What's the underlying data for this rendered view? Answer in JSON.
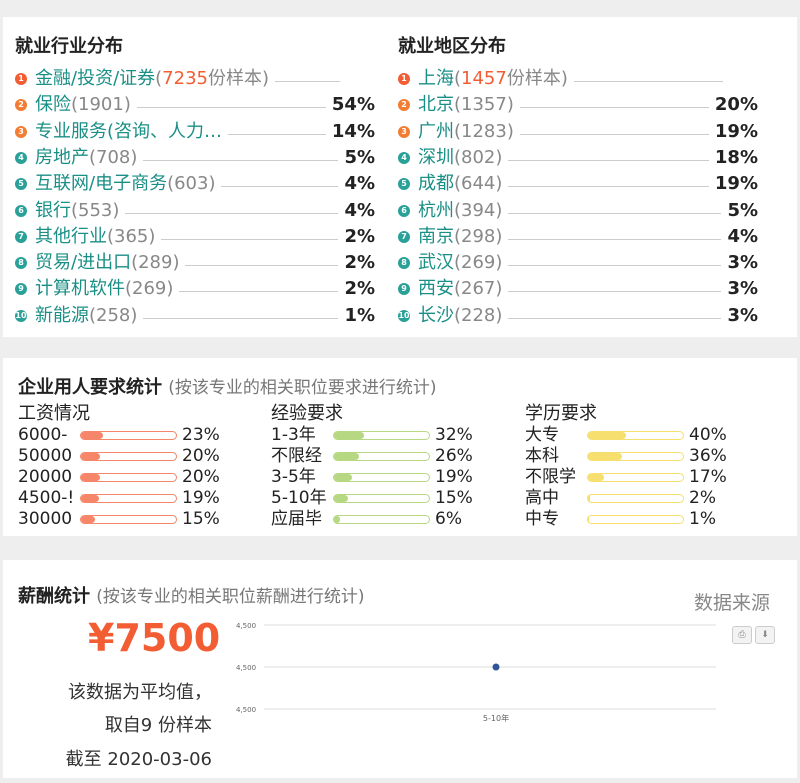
{
  "industry": {
    "title": "就业行业分布",
    "items": [
      {
        "rank": "1",
        "name": "金融/投资/证券",
        "count": "(",
        "count_hl": "7235",
        "count_tail": "份样本)",
        "pct": ""
      },
      {
        "rank": "2",
        "name": "保险",
        "count": "(1901)",
        "count_hl": "",
        "count_tail": "",
        "pct": "54%"
      },
      {
        "rank": "3",
        "name": "专业服务(咨询、人力…",
        "count": "",
        "count_hl": "",
        "count_tail": "",
        "pct": "14%"
      },
      {
        "rank": "4",
        "name": "房地产",
        "count": "(708)",
        "count_hl": "",
        "count_tail": "",
        "pct": "5%"
      },
      {
        "rank": "5",
        "name": "互联网/电子商务",
        "count": "(603)",
        "count_hl": "",
        "count_tail": "",
        "pct": "4%"
      },
      {
        "rank": "6",
        "name": "银行",
        "count": "(553)",
        "count_hl": "",
        "count_tail": "",
        "pct": "4%"
      },
      {
        "rank": "7",
        "name": "其他行业",
        "count": "(365)",
        "count_hl": "",
        "count_tail": "",
        "pct": "2%"
      },
      {
        "rank": "8",
        "name": "贸易/进出口",
        "count": "(289)",
        "count_hl": "",
        "count_tail": "",
        "pct": "2%"
      },
      {
        "rank": "9",
        "name": "计算机软件",
        "count": "(269)",
        "count_hl": "",
        "count_tail": "",
        "pct": "2%"
      },
      {
        "rank": "10",
        "name": "新能源",
        "count": "(258)",
        "count_hl": "",
        "count_tail": "",
        "pct": "1%"
      }
    ]
  },
  "region": {
    "title": "就业地区分布",
    "items": [
      {
        "rank": "1",
        "name": "上海",
        "count": "(",
        "count_hl": "1457",
        "count_tail": "份样本)",
        "pct": ""
      },
      {
        "rank": "2",
        "name": "北京",
        "count": "(1357)",
        "count_hl": "",
        "count_tail": "",
        "pct": "20%"
      },
      {
        "rank": "3",
        "name": "广州",
        "count": "(1283)",
        "count_hl": "",
        "count_tail": "",
        "pct": "19%"
      },
      {
        "rank": "4",
        "name": "深圳",
        "count": "(802)",
        "count_hl": "",
        "count_tail": "",
        "pct": "18%"
      },
      {
        "rank": "5",
        "name": "成都",
        "count": "(644)",
        "count_hl": "",
        "count_tail": "",
        "pct": "19%"
      },
      {
        "rank": "6",
        "name": "杭州",
        "count": "(394)",
        "count_hl": "",
        "count_tail": "",
        "pct": "5%"
      },
      {
        "rank": "7",
        "name": "南京",
        "count": "(298)",
        "count_hl": "",
        "count_tail": "",
        "pct": "4%"
      },
      {
        "rank": "8",
        "name": "武汉",
        "count": "(269)",
        "count_hl": "",
        "count_tail": "",
        "pct": "3%"
      },
      {
        "rank": "9",
        "name": "西安",
        "count": "(267)",
        "count_hl": "",
        "count_tail": "",
        "pct": "3%"
      },
      {
        "rank": "10",
        "name": "长沙",
        "count": "(228)",
        "count_hl": "",
        "count_tail": "",
        "pct": "3%"
      }
    ]
  },
  "requirements": {
    "title": "企业用人要求统计",
    "subtitle": "(按该专业的相关职位要求进行统计)",
    "groups": [
      {
        "head": "工资情况",
        "color": "#f5866a",
        "rows": [
          {
            "label": "6000-",
            "value": 23,
            "pct": "23%"
          },
          {
            "label": "50000",
            "value": 20,
            "pct": "20%"
          },
          {
            "label": "20000",
            "value": 20,
            "pct": "20%"
          },
          {
            "label": "4500-!",
            "value": 19,
            "pct": "19%"
          },
          {
            "label": "30000",
            "value": 15,
            "pct": "15%"
          }
        ]
      },
      {
        "head": "经验要求",
        "color": "#b6d883",
        "rows": [
          {
            "label": "1-3年",
            "value": 32,
            "pct": "32%"
          },
          {
            "label": "不限经",
            "value": 26,
            "pct": "26%"
          },
          {
            "label": "3-5年",
            "value": 19,
            "pct": "19%"
          },
          {
            "label": "5-10年",
            "value": 15,
            "pct": "15%"
          },
          {
            "label": "应届毕",
            "value": 6,
            "pct": "6%"
          }
        ]
      },
      {
        "head": "学历要求",
        "color": "#f6df6e",
        "rows": [
          {
            "label": "大专",
            "value": 40,
            "pct": "40%"
          },
          {
            "label": "本科",
            "value": 36,
            "pct": "36%"
          },
          {
            "label": "不限学",
            "value": 17,
            "pct": "17%"
          },
          {
            "label": "高中",
            "value": 2,
            "pct": "2%"
          },
          {
            "label": "中专",
            "value": 1,
            "pct": "1%"
          }
        ]
      }
    ]
  },
  "salary": {
    "title": "薪酬统计",
    "subtitle": "(按该专业的相关职位薪酬进行统计)",
    "source_link": "数据来源",
    "average": "¥7500",
    "note1": "该数据为平均值，",
    "note2": "取自9 份样本",
    "note3": "截至 2020-03-06",
    "print_icon": "print-icon",
    "download_icon": "download-icon"
  },
  "chart_data": {
    "type": "scatter",
    "categories": [
      "5-10年"
    ],
    "values": [
      4500
    ],
    "y_ticks": [
      "4,500",
      "4,500",
      "4,500"
    ],
    "grid": true,
    "point_color": "#2f5597"
  }
}
